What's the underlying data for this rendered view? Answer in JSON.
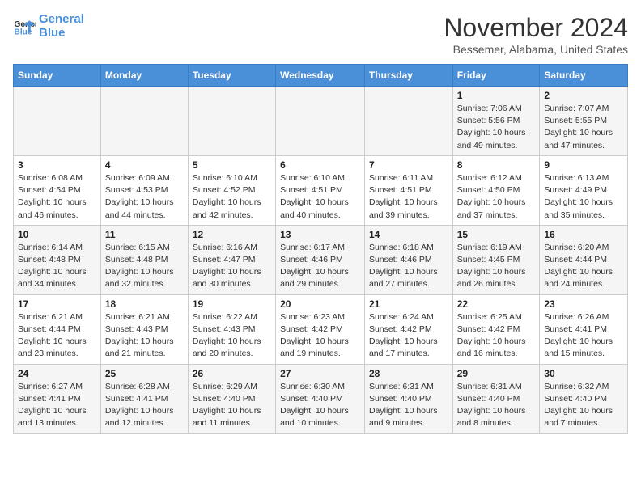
{
  "header": {
    "logo_line1": "General",
    "logo_line2": "Blue",
    "month": "November 2024",
    "location": "Bessemer, Alabama, United States"
  },
  "weekdays": [
    "Sunday",
    "Monday",
    "Tuesday",
    "Wednesday",
    "Thursday",
    "Friday",
    "Saturday"
  ],
  "weeks": [
    [
      {
        "day": "",
        "info": ""
      },
      {
        "day": "",
        "info": ""
      },
      {
        "day": "",
        "info": ""
      },
      {
        "day": "",
        "info": ""
      },
      {
        "day": "",
        "info": ""
      },
      {
        "day": "1",
        "info": "Sunrise: 7:06 AM\nSunset: 5:56 PM\nDaylight: 10 hours and 49 minutes."
      },
      {
        "day": "2",
        "info": "Sunrise: 7:07 AM\nSunset: 5:55 PM\nDaylight: 10 hours and 47 minutes."
      }
    ],
    [
      {
        "day": "3",
        "info": "Sunrise: 6:08 AM\nSunset: 4:54 PM\nDaylight: 10 hours and 46 minutes."
      },
      {
        "day": "4",
        "info": "Sunrise: 6:09 AM\nSunset: 4:53 PM\nDaylight: 10 hours and 44 minutes."
      },
      {
        "day": "5",
        "info": "Sunrise: 6:10 AM\nSunset: 4:52 PM\nDaylight: 10 hours and 42 minutes."
      },
      {
        "day": "6",
        "info": "Sunrise: 6:10 AM\nSunset: 4:51 PM\nDaylight: 10 hours and 40 minutes."
      },
      {
        "day": "7",
        "info": "Sunrise: 6:11 AM\nSunset: 4:51 PM\nDaylight: 10 hours and 39 minutes."
      },
      {
        "day": "8",
        "info": "Sunrise: 6:12 AM\nSunset: 4:50 PM\nDaylight: 10 hours and 37 minutes."
      },
      {
        "day": "9",
        "info": "Sunrise: 6:13 AM\nSunset: 4:49 PM\nDaylight: 10 hours and 35 minutes."
      }
    ],
    [
      {
        "day": "10",
        "info": "Sunrise: 6:14 AM\nSunset: 4:48 PM\nDaylight: 10 hours and 34 minutes."
      },
      {
        "day": "11",
        "info": "Sunrise: 6:15 AM\nSunset: 4:48 PM\nDaylight: 10 hours and 32 minutes."
      },
      {
        "day": "12",
        "info": "Sunrise: 6:16 AM\nSunset: 4:47 PM\nDaylight: 10 hours and 30 minutes."
      },
      {
        "day": "13",
        "info": "Sunrise: 6:17 AM\nSunset: 4:46 PM\nDaylight: 10 hours and 29 minutes."
      },
      {
        "day": "14",
        "info": "Sunrise: 6:18 AM\nSunset: 4:46 PM\nDaylight: 10 hours and 27 minutes."
      },
      {
        "day": "15",
        "info": "Sunrise: 6:19 AM\nSunset: 4:45 PM\nDaylight: 10 hours and 26 minutes."
      },
      {
        "day": "16",
        "info": "Sunrise: 6:20 AM\nSunset: 4:44 PM\nDaylight: 10 hours and 24 minutes."
      }
    ],
    [
      {
        "day": "17",
        "info": "Sunrise: 6:21 AM\nSunset: 4:44 PM\nDaylight: 10 hours and 23 minutes."
      },
      {
        "day": "18",
        "info": "Sunrise: 6:21 AM\nSunset: 4:43 PM\nDaylight: 10 hours and 21 minutes."
      },
      {
        "day": "19",
        "info": "Sunrise: 6:22 AM\nSunset: 4:43 PM\nDaylight: 10 hours and 20 minutes."
      },
      {
        "day": "20",
        "info": "Sunrise: 6:23 AM\nSunset: 4:42 PM\nDaylight: 10 hours and 19 minutes."
      },
      {
        "day": "21",
        "info": "Sunrise: 6:24 AM\nSunset: 4:42 PM\nDaylight: 10 hours and 17 minutes."
      },
      {
        "day": "22",
        "info": "Sunrise: 6:25 AM\nSunset: 4:42 PM\nDaylight: 10 hours and 16 minutes."
      },
      {
        "day": "23",
        "info": "Sunrise: 6:26 AM\nSunset: 4:41 PM\nDaylight: 10 hours and 15 minutes."
      }
    ],
    [
      {
        "day": "24",
        "info": "Sunrise: 6:27 AM\nSunset: 4:41 PM\nDaylight: 10 hours and 13 minutes."
      },
      {
        "day": "25",
        "info": "Sunrise: 6:28 AM\nSunset: 4:41 PM\nDaylight: 10 hours and 12 minutes."
      },
      {
        "day": "26",
        "info": "Sunrise: 6:29 AM\nSunset: 4:40 PM\nDaylight: 10 hours and 11 minutes."
      },
      {
        "day": "27",
        "info": "Sunrise: 6:30 AM\nSunset: 4:40 PM\nDaylight: 10 hours and 10 minutes."
      },
      {
        "day": "28",
        "info": "Sunrise: 6:31 AM\nSunset: 4:40 PM\nDaylight: 10 hours and 9 minutes."
      },
      {
        "day": "29",
        "info": "Sunrise: 6:31 AM\nSunset: 4:40 PM\nDaylight: 10 hours and 8 minutes."
      },
      {
        "day": "30",
        "info": "Sunrise: 6:32 AM\nSunset: 4:40 PM\nDaylight: 10 hours and 7 minutes."
      }
    ]
  ]
}
